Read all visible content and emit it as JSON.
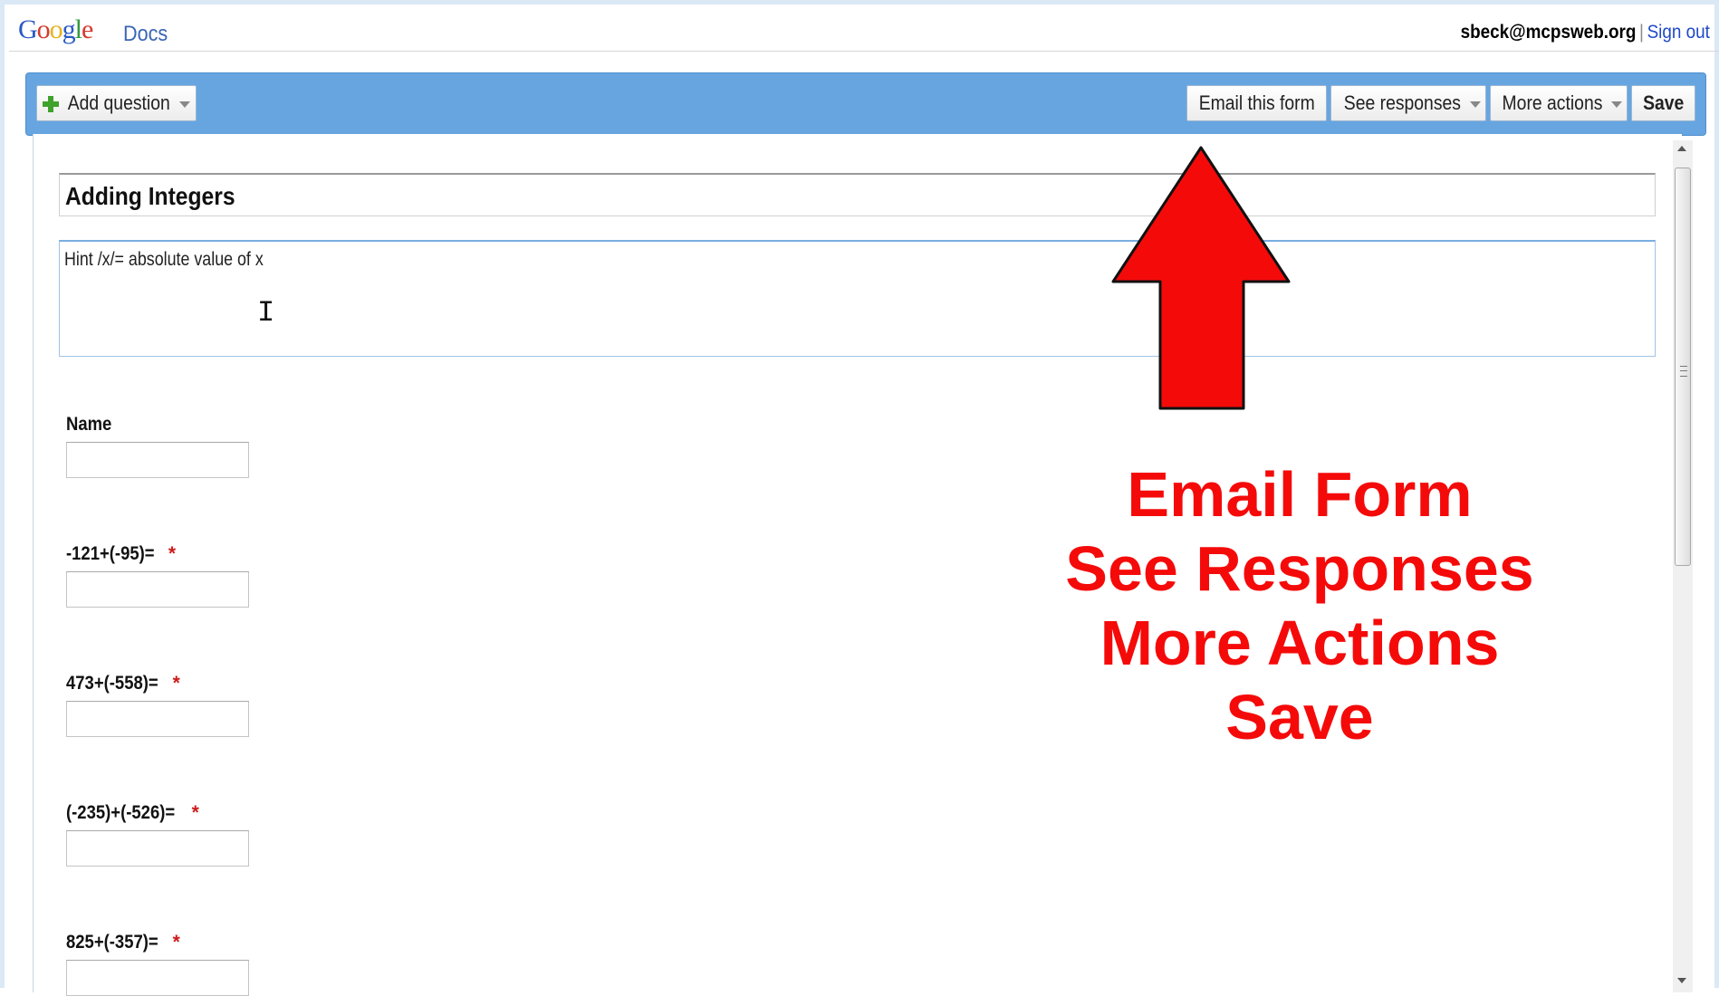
{
  "header": {
    "logo_word": "Google",
    "logo_product": "Docs",
    "account_email": "sbeck@mcpsweb.org",
    "separator": "|",
    "sign_out": "Sign out"
  },
  "toolbar": {
    "add_question": "Add question",
    "email_form": "Email this form",
    "see_responses": "See responses",
    "more_actions": "More actions",
    "save": "Save"
  },
  "form": {
    "title": "Adding Integers",
    "description": "Hint /x/= absolute value of x",
    "required_marker": "*",
    "questions": [
      {
        "label": "Name",
        "required": false
      },
      {
        "label": "-121+(-95)=",
        "required": true
      },
      {
        "label": "473+(-558)=",
        "required": true
      },
      {
        "label": "(-235)+(-526)=",
        "required": true
      },
      {
        "label": "825+(-357)=",
        "required": true
      }
    ]
  },
  "annotation": {
    "lines": [
      "Email Form",
      "See Responses",
      "More Actions",
      "Save"
    ],
    "color": "#f50a0a"
  },
  "colors": {
    "toolbar_blue": "#66a5e0",
    "link_blue": "#1f49c9",
    "required_red": "#cc1b1b"
  }
}
